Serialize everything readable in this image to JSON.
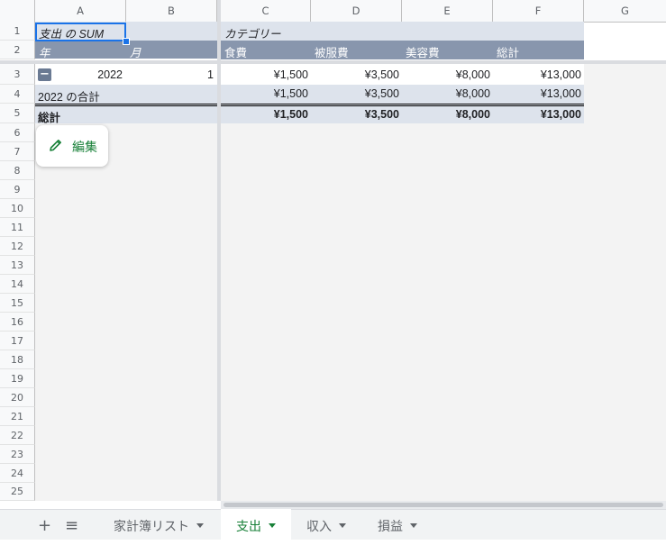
{
  "columns": [
    "A",
    "B",
    "C",
    "D",
    "E",
    "F",
    "G"
  ],
  "rows": [
    "1",
    "2",
    "3",
    "4",
    "5",
    "6",
    "7",
    "8",
    "9",
    "10",
    "11",
    "12",
    "13",
    "14",
    "15",
    "16",
    "17",
    "18",
    "19",
    "20",
    "21",
    "22",
    "23",
    "24",
    "25"
  ],
  "pivot": {
    "value_label": "支出 の SUM",
    "category_label": "カテゴリー",
    "row_label_year": "年",
    "row_label_month": "月",
    "categories": [
      "食費",
      "被服費",
      "美容費",
      "総計"
    ],
    "data_row": {
      "year": "2022",
      "month": "1",
      "values": [
        "¥1,500",
        "¥3,500",
        "¥8,000",
        "¥13,000"
      ]
    },
    "subtotal_row": {
      "label": "2022 の合計",
      "values": [
        "¥1,500",
        "¥3,500",
        "¥8,000",
        "¥13,000"
      ]
    },
    "grand_total_row": {
      "label": "総計",
      "values": [
        "¥1,500",
        "¥3,500",
        "¥8,000",
        "¥13,000"
      ]
    },
    "collapse_symbol": "−"
  },
  "edit_button": {
    "label": "編集"
  },
  "sheet_tabs": [
    {
      "label": "家計簿リスト",
      "active": false
    },
    {
      "label": "支出",
      "active": true
    },
    {
      "label": "収入",
      "active": false
    },
    {
      "label": "損益",
      "active": false
    }
  ],
  "icons": {
    "add_sheet": "+",
    "all_sheets": "≡"
  },
  "colors": {
    "header_band": "#8896ad",
    "light_band": "#dde3ec",
    "active_tab": "#188038"
  }
}
